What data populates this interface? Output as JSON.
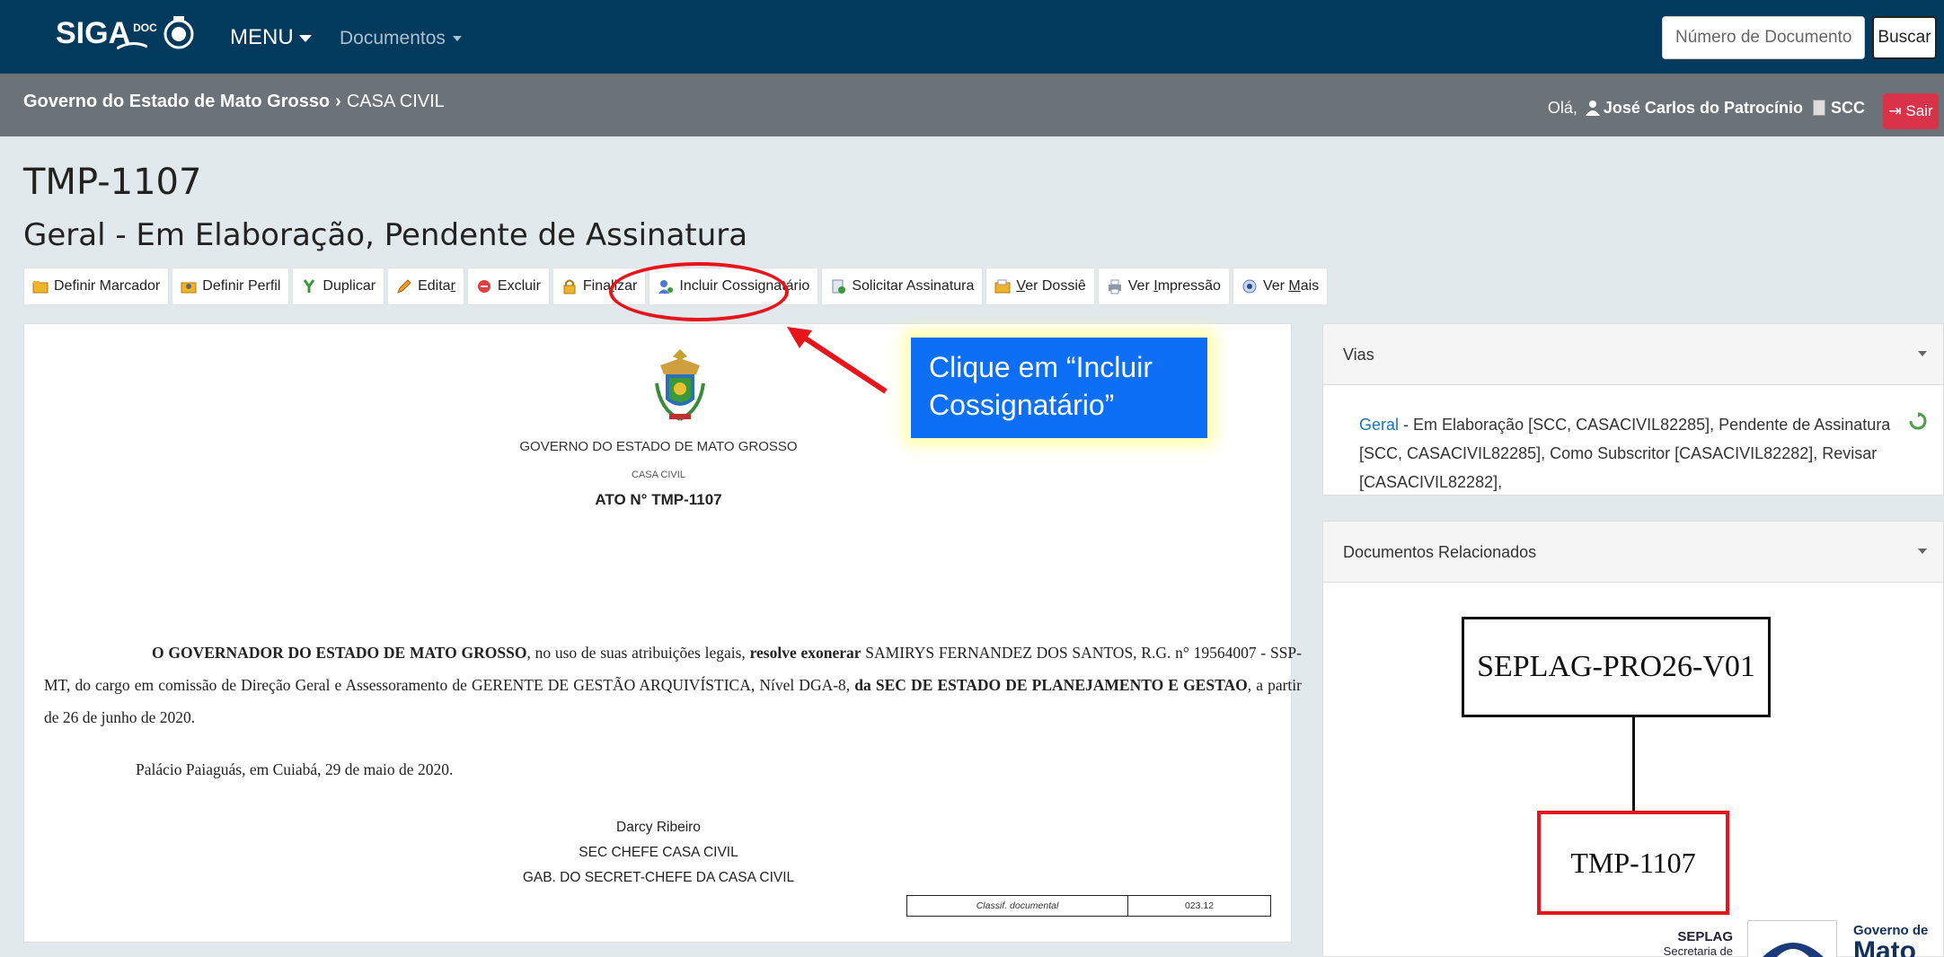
{
  "navbar": {
    "brand": "SIGA",
    "brand_sup": "DOC",
    "menu_label": "MENU",
    "documents_label": "Documentos",
    "search_placeholder": "Número de Documento",
    "search_button": "Buscar"
  },
  "subbar": {
    "breadcrumb_root": "Governo do Estado de Mato Grosso",
    "breadcrumb_separator": "›",
    "breadcrumb_current": "CASA CIVIL",
    "greeting": "Olá,",
    "user_name": "José Carlos do Patrocínio",
    "user_unit": "SCC",
    "logout": "Sair"
  },
  "document": {
    "id": "TMP-1107",
    "status": "Geral - Em Elaboração, Pendente de Assinatura"
  },
  "toolbar": {
    "definir_marcador": "Definir Marcador",
    "definir_perfil": "Definir Perfil",
    "duplicar": "Duplicar",
    "editar_pre": "Edita",
    "editar_u": "r",
    "excluir": "Excluir",
    "finalizar_pre": "Fina",
    "finalizar_u": "l",
    "finalizar_post": "izar",
    "incluir_cossignatario": "Incluir Cossignatário",
    "solicitar_assinatura": "Solicitar Assinatura",
    "ver_dossie_u": "V",
    "ver_dossie_post": "er Dossiê",
    "ver_impressao_pre": "Ver ",
    "ver_impressao_u": "I",
    "ver_impressao_post": "mpressão",
    "ver_mais_pre": "Ver ",
    "ver_mais_u": "M",
    "ver_mais_post": "ais"
  },
  "doc_content": {
    "gov_title": "GOVERNO DO ESTADO DE MATO GROSSO",
    "gov_sub": "CASA CIVIL",
    "ato": "ATO N° TMP-1107",
    "body_bold_1": "O GOVERNADOR DO ESTADO DE MATO GROSSO",
    "body_1": ", no uso de suas atribuições legais, ",
    "body_bold_2": "resolve exonerar",
    "body_2": " SAMIRYS FERNANDEZ DOS SANTOS, R.G. n° 19564007 - SSP-MT, do cargo em comissão de Direção Geral e Assessoramento de GERENTE DE GESTÃO ARQUIVÍSTICA, Nível DGA-8, ",
    "body_bold_3": "da SEC DE ESTADO DE PLANEJAMENTO E GESTAO",
    "body_3": ", a partir de 26 de junho de 2020.",
    "place_date": "Palácio Paiaguás, em Cuiabá, 29 de maio de 2020.",
    "signer_name": "Darcy Ribeiro",
    "signer_role": "SEC CHEFE CASA CIVIL",
    "signer_office": "GAB. DO SECRET-CHEFE DA CASA CIVIL",
    "classif_label": "Classif. documental",
    "classif_value": "023.12"
  },
  "annotation": {
    "callout_text": "Clique em “Incluir Cossignatário”"
  },
  "vias": {
    "title": "Vias",
    "link": "Geral",
    "text": "  -  Em Elaboração [SCC, CASACIVIL82285], Pendente de Assinatura [SCC, CASACIVIL82285], Como Subscritor [CASACIVIL82282], Revisar [CASACIVIL82282],"
  },
  "related": {
    "title": "Documentos Relacionados",
    "parent": "SEPLAG-PRO26-V01",
    "child": "TMP-1107",
    "seplag_name": "SEPLAG",
    "seplag_sub": "Secretaria de",
    "gov_logo_line1": "Governo de",
    "gov_logo_line2": "Mato"
  },
  "colors": {
    "navbar": "#023a5d",
    "subbar": "#6b7378",
    "background": "#e1e9ec",
    "logout": "#d9334a",
    "highlight_red": "#e8141b",
    "callout_blue": "#0d6ff5",
    "link": "#1a73b8"
  }
}
